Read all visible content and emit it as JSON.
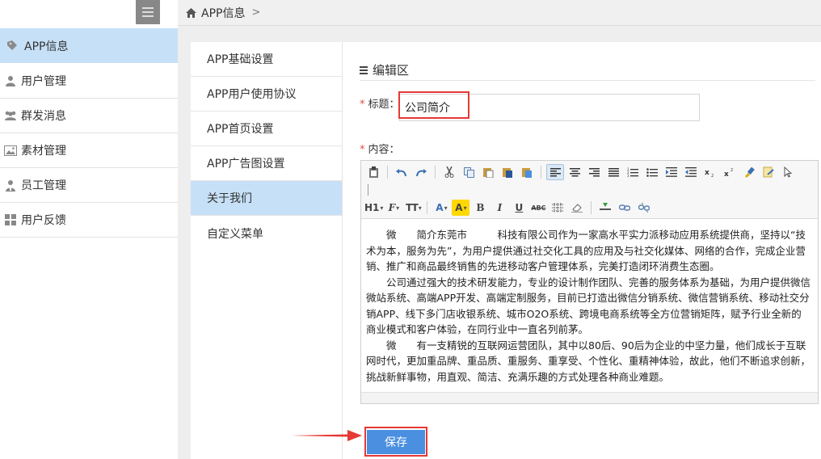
{
  "sidebar": {
    "items": [
      {
        "label": "APP信息",
        "icon": "tag-icon"
      },
      {
        "label": "用户管理",
        "icon": "user-icon"
      },
      {
        "label": "群发消息",
        "icon": "users-icon"
      },
      {
        "label": "素材管理",
        "icon": "image-icon"
      },
      {
        "label": "员工管理",
        "icon": "staff-icon"
      },
      {
        "label": "用户反馈",
        "icon": "grid-icon"
      }
    ]
  },
  "breadcrumb": {
    "current": "APP信息",
    "separator": ">"
  },
  "subnav": {
    "items": [
      {
        "label": "APP基础设置"
      },
      {
        "label": "APP用户使用协议"
      },
      {
        "label": "APP首页设置"
      },
      {
        "label": "APP广告图设置"
      },
      {
        "label": "关于我们"
      },
      {
        "label": "自定义菜单"
      }
    ]
  },
  "editor": {
    "section_title": "编辑区",
    "required_mark": "*",
    "title_label": "标题：",
    "title_value": "公司简介",
    "content_label": "内容：",
    "paragraphs": [
      "微　　简介东莞市　　　科技有限公司作为一家高水平实力派移动应用系统提供商，坚持以“技术为本，服务为先”，为用户提供通过社交化工具的应用及与社交化媒体、网络的合作，完成企业营销、推广和商品最终销售的先进移动客户管理体系，完美打造闭环消费生态圈。",
      "公司通过强大的技术研发能力，专业的设计制作团队、完善的服务体系为基础，为用户提供微信微站系统、高端APP开发、高端定制服务，目前已打造出微信分销系统、微信营销系统、移动社交分销APP、线下多门店收银系统、城市O2O系统、跨境电商系统等全方位营销矩阵，赋予行业全新的商业模式和客户体验，在同行业中一直名列前茅。",
      "微　　有一支精锐的互联网运营团队，其中以80后、90后为企业的中坚力量，他们成长于互联网时代，更加重品牌、重品质、重服务、重享受、个性化、重精神体验，故此，他们不断追求创新，挑战新鲜事物，用直观、简洁、充满乐趣的方式处理各种商业难题。"
    ]
  },
  "toolbar": {
    "row1": [
      "paste-icon",
      "undo-icon",
      "redo-icon",
      "cut-icon",
      "copy-icon",
      "paste-text-icon",
      "paste-word-icon",
      "paste-html-icon",
      "align-left-icon",
      "align-center-icon",
      "align-right-icon",
      "align-justify-icon",
      "ordered-list-icon",
      "unordered-list-icon",
      "indent-icon",
      "outdent-icon",
      "subscript-icon",
      "superscript-icon",
      "format-brush-icon",
      "clear-format-icon",
      "select-all-icon"
    ],
    "heading": "H1",
    "font": "F",
    "size": "TT",
    "font_color": "A",
    "highlight": "A",
    "bold": "B",
    "italic": "I",
    "underline": "U",
    "strike": "ABC"
  },
  "actions": {
    "save_label": "保存"
  },
  "colors": {
    "accent": "#4a8fe0",
    "active_bg": "#c6e0f7",
    "highlight_border": "#e53935"
  }
}
